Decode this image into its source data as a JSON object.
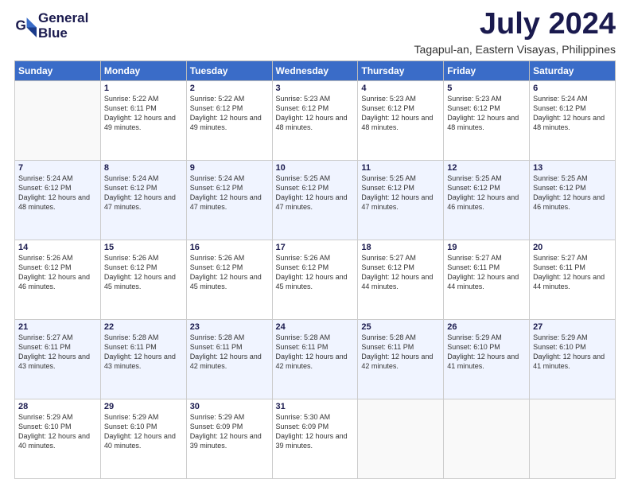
{
  "logo": {
    "line1": "General",
    "line2": "Blue"
  },
  "title": "July 2024",
  "subtitle": "Tagapul-an, Eastern Visayas, Philippines",
  "weekdays": [
    "Sunday",
    "Monday",
    "Tuesday",
    "Wednesday",
    "Thursday",
    "Friday",
    "Saturday"
  ],
  "weeks": [
    [
      {
        "num": "",
        "sunrise": "",
        "sunset": "",
        "daylight": ""
      },
      {
        "num": "1",
        "sunrise": "Sunrise: 5:22 AM",
        "sunset": "Sunset: 6:11 PM",
        "daylight": "Daylight: 12 hours and 49 minutes."
      },
      {
        "num": "2",
        "sunrise": "Sunrise: 5:22 AM",
        "sunset": "Sunset: 6:12 PM",
        "daylight": "Daylight: 12 hours and 49 minutes."
      },
      {
        "num": "3",
        "sunrise": "Sunrise: 5:23 AM",
        "sunset": "Sunset: 6:12 PM",
        "daylight": "Daylight: 12 hours and 48 minutes."
      },
      {
        "num": "4",
        "sunrise": "Sunrise: 5:23 AM",
        "sunset": "Sunset: 6:12 PM",
        "daylight": "Daylight: 12 hours and 48 minutes."
      },
      {
        "num": "5",
        "sunrise": "Sunrise: 5:23 AM",
        "sunset": "Sunset: 6:12 PM",
        "daylight": "Daylight: 12 hours and 48 minutes."
      },
      {
        "num": "6",
        "sunrise": "Sunrise: 5:24 AM",
        "sunset": "Sunset: 6:12 PM",
        "daylight": "Daylight: 12 hours and 48 minutes."
      }
    ],
    [
      {
        "num": "7",
        "sunrise": "Sunrise: 5:24 AM",
        "sunset": "Sunset: 6:12 PM",
        "daylight": "Daylight: 12 hours and 48 minutes."
      },
      {
        "num": "8",
        "sunrise": "Sunrise: 5:24 AM",
        "sunset": "Sunset: 6:12 PM",
        "daylight": "Daylight: 12 hours and 47 minutes."
      },
      {
        "num": "9",
        "sunrise": "Sunrise: 5:24 AM",
        "sunset": "Sunset: 6:12 PM",
        "daylight": "Daylight: 12 hours and 47 minutes."
      },
      {
        "num": "10",
        "sunrise": "Sunrise: 5:25 AM",
        "sunset": "Sunset: 6:12 PM",
        "daylight": "Daylight: 12 hours and 47 minutes."
      },
      {
        "num": "11",
        "sunrise": "Sunrise: 5:25 AM",
        "sunset": "Sunset: 6:12 PM",
        "daylight": "Daylight: 12 hours and 47 minutes."
      },
      {
        "num": "12",
        "sunrise": "Sunrise: 5:25 AM",
        "sunset": "Sunset: 6:12 PM",
        "daylight": "Daylight: 12 hours and 46 minutes."
      },
      {
        "num": "13",
        "sunrise": "Sunrise: 5:25 AM",
        "sunset": "Sunset: 6:12 PM",
        "daylight": "Daylight: 12 hours and 46 minutes."
      }
    ],
    [
      {
        "num": "14",
        "sunrise": "Sunrise: 5:26 AM",
        "sunset": "Sunset: 6:12 PM",
        "daylight": "Daylight: 12 hours and 46 minutes."
      },
      {
        "num": "15",
        "sunrise": "Sunrise: 5:26 AM",
        "sunset": "Sunset: 6:12 PM",
        "daylight": "Daylight: 12 hours and 45 minutes."
      },
      {
        "num": "16",
        "sunrise": "Sunrise: 5:26 AM",
        "sunset": "Sunset: 6:12 PM",
        "daylight": "Daylight: 12 hours and 45 minutes."
      },
      {
        "num": "17",
        "sunrise": "Sunrise: 5:26 AM",
        "sunset": "Sunset: 6:12 PM",
        "daylight": "Daylight: 12 hours and 45 minutes."
      },
      {
        "num": "18",
        "sunrise": "Sunrise: 5:27 AM",
        "sunset": "Sunset: 6:12 PM",
        "daylight": "Daylight: 12 hours and 44 minutes."
      },
      {
        "num": "19",
        "sunrise": "Sunrise: 5:27 AM",
        "sunset": "Sunset: 6:11 PM",
        "daylight": "Daylight: 12 hours and 44 minutes."
      },
      {
        "num": "20",
        "sunrise": "Sunrise: 5:27 AM",
        "sunset": "Sunset: 6:11 PM",
        "daylight": "Daylight: 12 hours and 44 minutes."
      }
    ],
    [
      {
        "num": "21",
        "sunrise": "Sunrise: 5:27 AM",
        "sunset": "Sunset: 6:11 PM",
        "daylight": "Daylight: 12 hours and 43 minutes."
      },
      {
        "num": "22",
        "sunrise": "Sunrise: 5:28 AM",
        "sunset": "Sunset: 6:11 PM",
        "daylight": "Daylight: 12 hours and 43 minutes."
      },
      {
        "num": "23",
        "sunrise": "Sunrise: 5:28 AM",
        "sunset": "Sunset: 6:11 PM",
        "daylight": "Daylight: 12 hours and 42 minutes."
      },
      {
        "num": "24",
        "sunrise": "Sunrise: 5:28 AM",
        "sunset": "Sunset: 6:11 PM",
        "daylight": "Daylight: 12 hours and 42 minutes."
      },
      {
        "num": "25",
        "sunrise": "Sunrise: 5:28 AM",
        "sunset": "Sunset: 6:11 PM",
        "daylight": "Daylight: 12 hours and 42 minutes."
      },
      {
        "num": "26",
        "sunrise": "Sunrise: 5:29 AM",
        "sunset": "Sunset: 6:10 PM",
        "daylight": "Daylight: 12 hours and 41 minutes."
      },
      {
        "num": "27",
        "sunrise": "Sunrise: 5:29 AM",
        "sunset": "Sunset: 6:10 PM",
        "daylight": "Daylight: 12 hours and 41 minutes."
      }
    ],
    [
      {
        "num": "28",
        "sunrise": "Sunrise: 5:29 AM",
        "sunset": "Sunset: 6:10 PM",
        "daylight": "Daylight: 12 hours and 40 minutes."
      },
      {
        "num": "29",
        "sunrise": "Sunrise: 5:29 AM",
        "sunset": "Sunset: 6:10 PM",
        "daylight": "Daylight: 12 hours and 40 minutes."
      },
      {
        "num": "30",
        "sunrise": "Sunrise: 5:29 AM",
        "sunset": "Sunset: 6:09 PM",
        "daylight": "Daylight: 12 hours and 39 minutes."
      },
      {
        "num": "31",
        "sunrise": "Sunrise: 5:30 AM",
        "sunset": "Sunset: 6:09 PM",
        "daylight": "Daylight: 12 hours and 39 minutes."
      },
      {
        "num": "",
        "sunrise": "",
        "sunset": "",
        "daylight": ""
      },
      {
        "num": "",
        "sunrise": "",
        "sunset": "",
        "daylight": ""
      },
      {
        "num": "",
        "sunrise": "",
        "sunset": "",
        "daylight": ""
      }
    ]
  ]
}
